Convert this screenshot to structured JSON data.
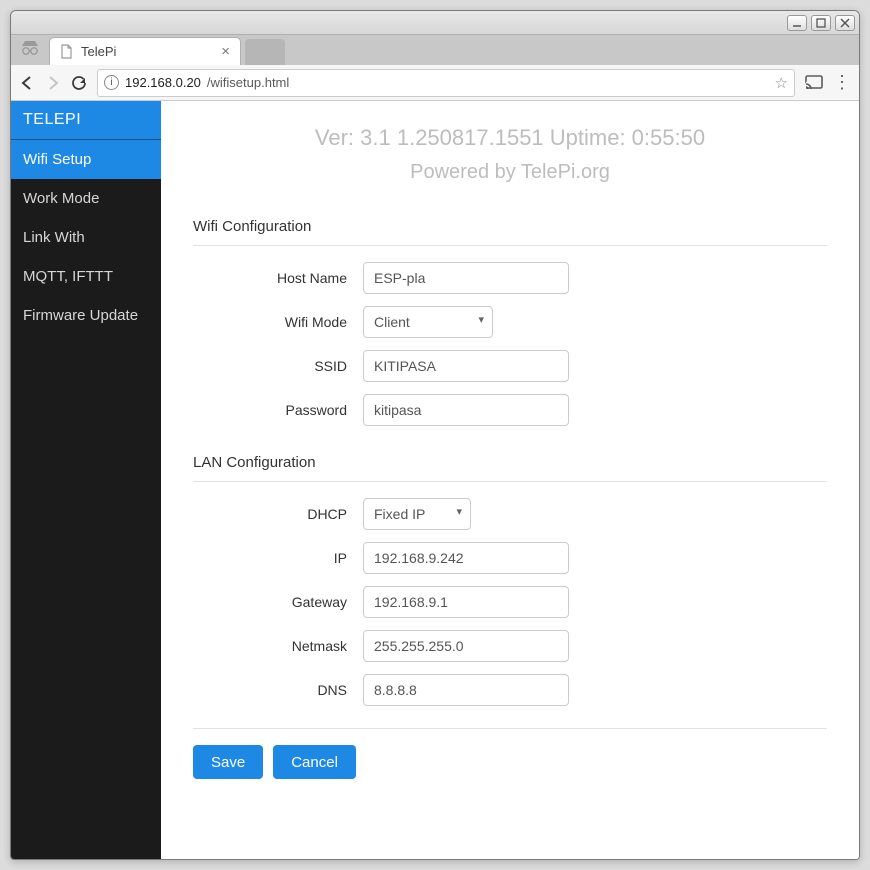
{
  "window": {
    "tab_title": "TelePi",
    "url_host": "192.168.0.20",
    "url_path": "/wifisetup.html"
  },
  "sidebar": {
    "brand": "TELEPI",
    "items": [
      {
        "label": "Wifi Setup",
        "active": true
      },
      {
        "label": "Work Mode",
        "active": false
      },
      {
        "label": "Link With",
        "active": false
      },
      {
        "label": "MQTT, IFTTT",
        "active": false
      },
      {
        "label": "Firmware Update",
        "active": false
      }
    ]
  },
  "header": {
    "version_line": "Ver: 3.1 1.250817.1551 Uptime: 0:55:50",
    "powered": "Powered by TelePi.org"
  },
  "sections": {
    "wifi_title": "Wifi Configuration",
    "lan_title": "LAN Configuration"
  },
  "labels": {
    "hostname": "Host Name",
    "wifi_mode": "Wifi Mode",
    "ssid": "SSID",
    "password": "Password",
    "dhcp": "DHCP",
    "ip": "IP",
    "gateway": "Gateway",
    "netmask": "Netmask",
    "dns": "DNS"
  },
  "values": {
    "hostname": "ESP-pla",
    "wifi_mode": "Client",
    "ssid": "KITIPASA",
    "password": "kitipasa",
    "dhcp": "Fixed IP",
    "ip": "192.168.9.242",
    "gateway": "192.168.9.1",
    "netmask": "255.255.255.0",
    "dns": "8.8.8.8"
  },
  "buttons": {
    "save": "Save",
    "cancel": "Cancel"
  }
}
